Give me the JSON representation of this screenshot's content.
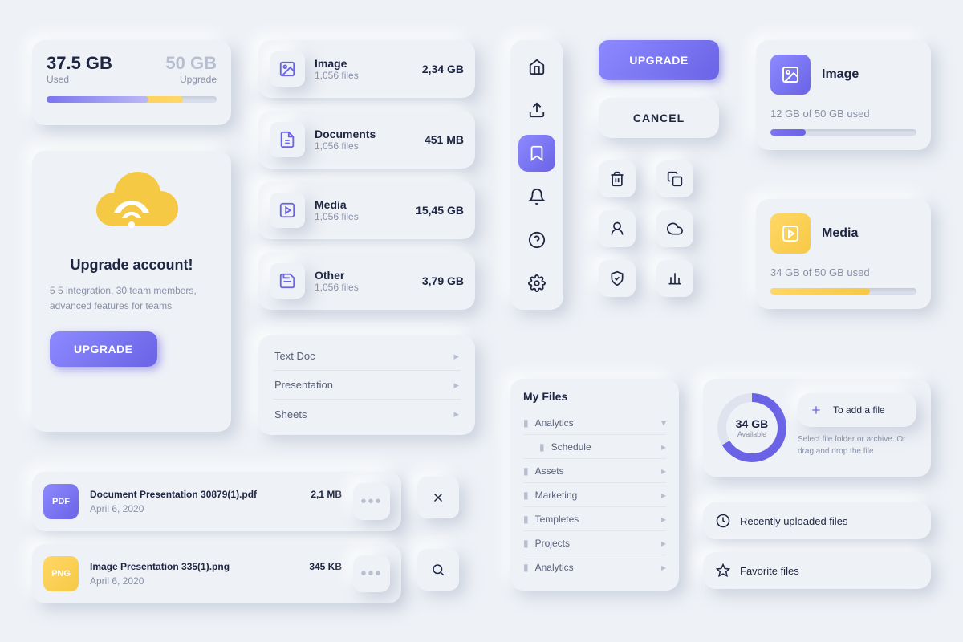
{
  "storage": {
    "used_value": "37.5 GB",
    "used_label": "Used",
    "total_value": "50 GB",
    "total_label": "Upgrade"
  },
  "upgrade_card": {
    "title": "Upgrade account!",
    "desc": "5 5 integration, 30 team members, advanced features for teams",
    "button": "UPGRADE"
  },
  "categories": [
    {
      "name": "Image",
      "files": "1,056 files",
      "size": "2,34 GB"
    },
    {
      "name": "Documents",
      "files": "1,056 files",
      "size": "451 MB"
    },
    {
      "name": "Media",
      "files": "1,056 files",
      "size": "15,45 GB"
    },
    {
      "name": "Other",
      "files": "1,056 files",
      "size": "3,79 GB"
    }
  ],
  "doc_types": [
    {
      "label": "Text Doc"
    },
    {
      "label": "Presentation"
    },
    {
      "label": "Sheets"
    }
  ],
  "files": [
    {
      "badge": "PDF",
      "name": "Document Presentation 30879(1).pdf",
      "size": "2,1 MB",
      "date": "April 6, 2020"
    },
    {
      "badge": "PNG",
      "name": "Image Presentation 335(1).png",
      "size": "345 KB",
      "date": "April 6, 2020"
    }
  ],
  "actions": {
    "upgrade": "UPGRADE",
    "cancel": "CANCEL"
  },
  "usage_cards": {
    "image": {
      "title": "Image",
      "text": "12 GB of 50 GB used"
    },
    "media": {
      "title": "Media",
      "text": "34 GB of 50 GB used"
    }
  },
  "my_files": {
    "title": "My Files",
    "items": [
      "Analytics",
      "Schedule",
      "Assets",
      "Marketing",
      "Templetes",
      "Projects",
      "Analytics"
    ]
  },
  "available": {
    "value": "34 GB",
    "label": "Available",
    "add_label": "To add a file",
    "hint": "Select file folder or archive. Or drag and drop the file"
  },
  "quick_links": {
    "recent": "Recently uploaded files",
    "favorite": "Favorite files"
  }
}
